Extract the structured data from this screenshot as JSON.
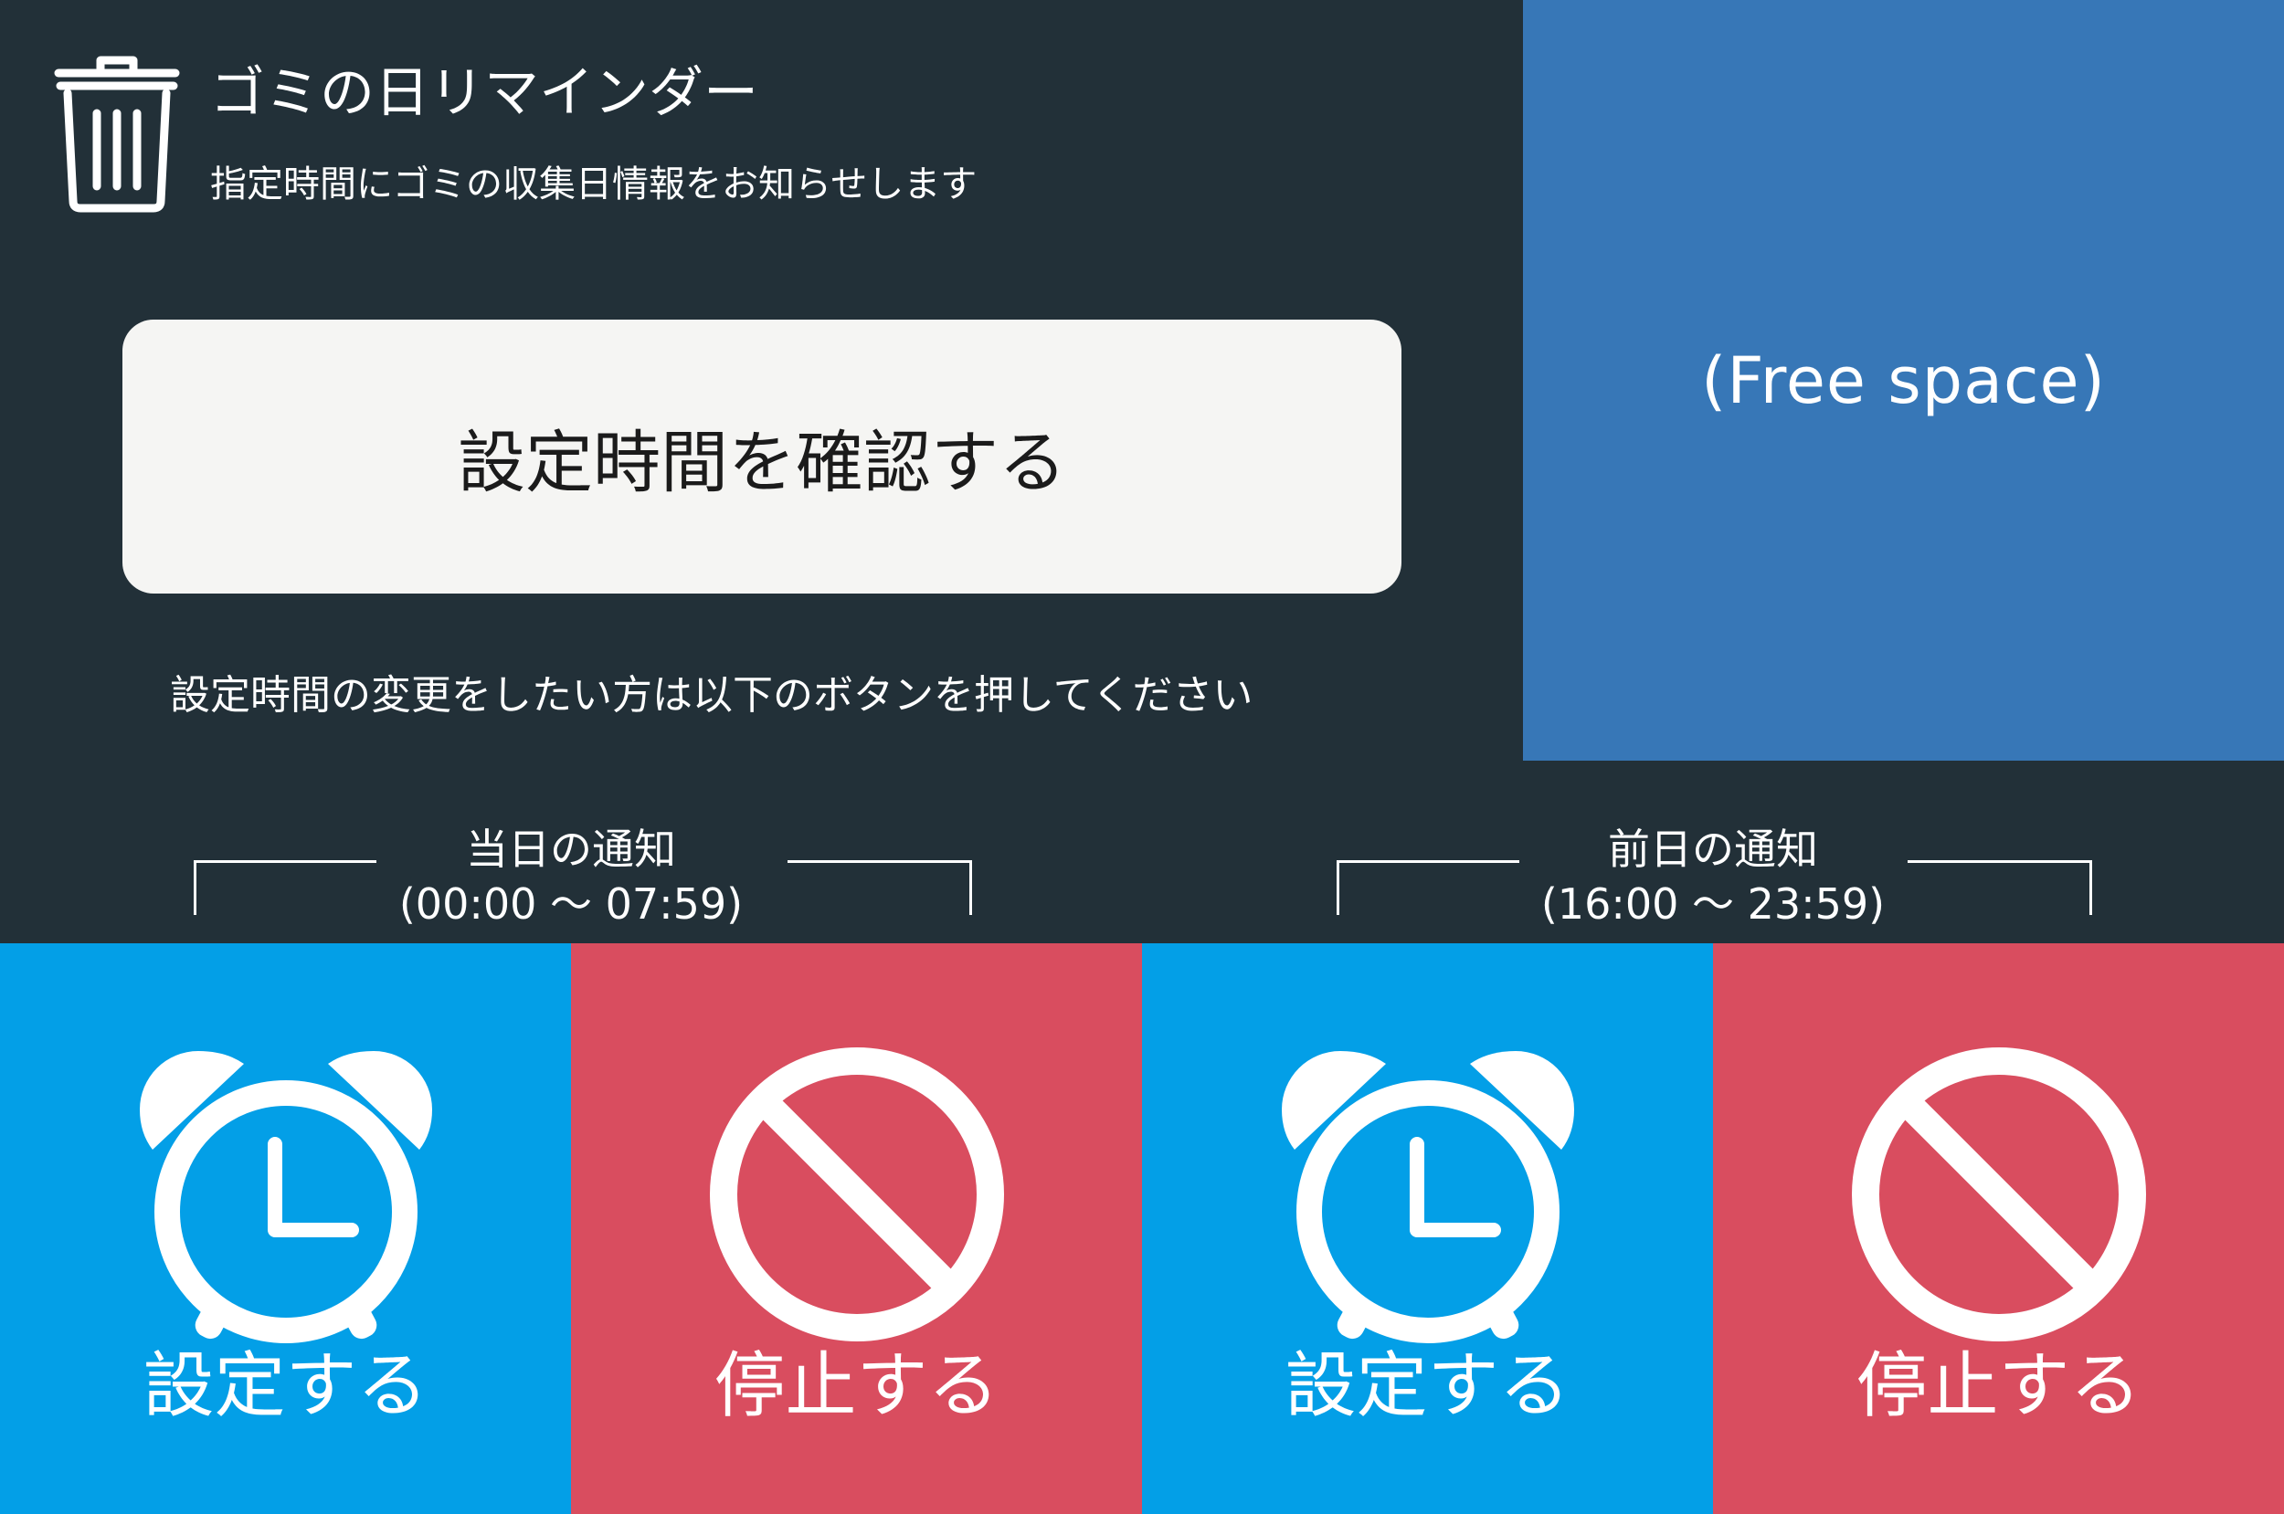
{
  "header": {
    "title": "ゴミの日リマインダー",
    "subtitle": "指定時間にゴミの収集日情報をお知らせします",
    "icon": "trash-icon"
  },
  "main": {
    "check_button_label": "設定時間を確認する",
    "change_note": "設定時間の変更をしたい方は以下のボタンを押してください"
  },
  "free_space": {
    "label": "(Free space)"
  },
  "groups": [
    {
      "title": "当日の通知",
      "range": "(00:00 ～ 07:59)",
      "set_label": "設定する",
      "stop_label": "停止する"
    },
    {
      "title": "前日の通知",
      "range": "(16:00 ～ 23:59)",
      "set_label": "設定する",
      "stop_label": "停止する"
    }
  ],
  "colors": {
    "background": "#223038",
    "free_space": "#3777b7",
    "set_tile": "#039fe7",
    "stop_tile": "#d94d5f",
    "button": "#f5f5f3"
  }
}
